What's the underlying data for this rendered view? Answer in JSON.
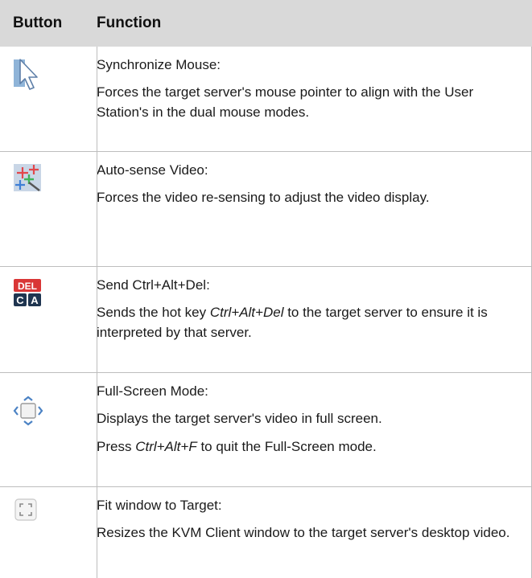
{
  "header": {
    "col_button": "Button",
    "col_function": "Function"
  },
  "rows": [
    {
      "icon": "pointer-arrow-icon",
      "title": "Synchronize Mouse:",
      "desc": [
        "Forces the target server's mouse pointer to align with the User Station's in the dual mouse modes."
      ]
    },
    {
      "icon": "auto-sense-video-icon",
      "title": "Auto-sense Video:",
      "desc": [
        "Forces the video re-sensing to adjust the video display."
      ]
    },
    {
      "icon": "ctrl-alt-del-icon",
      "title": "Send Ctrl+Alt+Del:",
      "desc_pre": "Sends the hot key ",
      "desc_em": "Ctrl+Alt+Del",
      "desc_post": " to the target server to ensure it is interpreted by that server.",
      "icon_text": {
        "top": "DEL",
        "left": "C",
        "right": "A"
      }
    },
    {
      "icon": "full-screen-icon",
      "title": "Full-Screen Mode:",
      "desc": [
        "Displays the target server's video in full screen."
      ],
      "desc2_pre": "Press ",
      "desc2_em": "Ctrl+Alt+F",
      "desc2_post": " to quit the Full-Screen mode."
    },
    {
      "icon": "fit-window-icon",
      "title": "Fit window to Target:",
      "desc": [
        "Resizes the KVM Client window to the target server's desktop video."
      ]
    }
  ]
}
